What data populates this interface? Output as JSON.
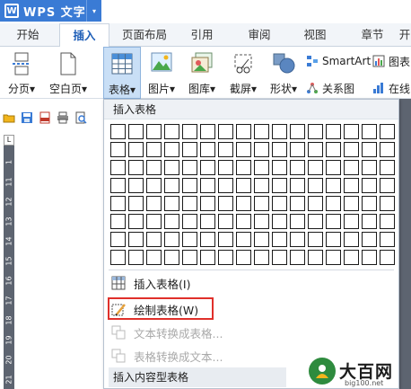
{
  "app": {
    "title": "WPS 文字",
    "logo_letter": "W",
    "dropdown_glyph": "▾",
    "accent": "#3a7bd5"
  },
  "tabs": [
    {
      "label": "开始"
    },
    {
      "label": "插入",
      "active": true
    },
    {
      "label": "页面布局"
    },
    {
      "label": "引用"
    },
    {
      "label": "审阅"
    },
    {
      "label": "视图"
    },
    {
      "label": "章节"
    },
    {
      "label": "开"
    }
  ],
  "ribbon": {
    "page_break": "分页",
    "blank_page": "空白页",
    "table": "表格",
    "picture": "图片",
    "gallery": "图库",
    "screenshot": "截屏",
    "shapes": "形状",
    "smartart": "SmartArt",
    "chart": "图表",
    "relation_graph": "关系图",
    "online": "在线",
    "caret": "▾"
  },
  "ruler": {
    "corner": "L",
    "numbers": [
      "1",
      "11",
      "12",
      "13",
      "14",
      "15",
      "16",
      "17",
      "18",
      "19",
      "20",
      "21",
      "22"
    ]
  },
  "dropdown": {
    "header": "插入表格",
    "grid_cols": 16,
    "grid_rows": 8,
    "items": [
      {
        "label": "插入表格(I)",
        "icon": "table-icon",
        "enabled": true
      },
      {
        "label": "绘制表格(W)",
        "icon": "pencil-table-icon",
        "enabled": true,
        "highlighted": true
      },
      {
        "label": "文本转换成表格...",
        "icon": "text-to-table-icon",
        "enabled": false
      },
      {
        "label": "表格转换成文本...",
        "icon": "table-to-text-icon",
        "enabled": false
      }
    ],
    "footer": "插入内容型表格",
    "highlight_color": "#e0302b"
  },
  "watermark": {
    "text": "大百网",
    "sub": "big100.net"
  }
}
